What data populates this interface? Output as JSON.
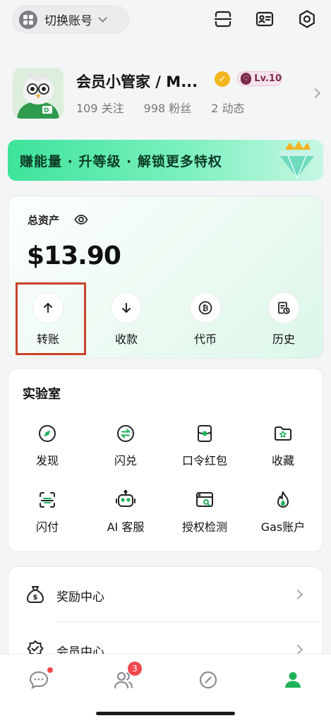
{
  "topbar": {
    "switch_label": "切换账号"
  },
  "profile": {
    "name": "会员小管家 / M...",
    "verified_mark": "✓",
    "level": "Lv.10",
    "following": "109 关注",
    "followers": "998 粉丝",
    "posts": "2 动态"
  },
  "banner": {
    "text": "赚能量 · 升等级 · 解锁更多特权"
  },
  "assets": {
    "title": "总资产",
    "amount": "$13.90",
    "actions": [
      {
        "label": "转账",
        "icon": "arrow-up-icon"
      },
      {
        "label": "收款",
        "icon": "arrow-down-icon"
      },
      {
        "label": "代币",
        "icon": "coin-icon"
      },
      {
        "label": "历史",
        "icon": "history-icon"
      }
    ]
  },
  "lab": {
    "title": "实验室",
    "items": [
      {
        "label": "发现",
        "icon": "compass-icon"
      },
      {
        "label": "闪兑",
        "icon": "swap-icon"
      },
      {
        "label": "口令红包",
        "icon": "red-packet-icon"
      },
      {
        "label": "收藏",
        "icon": "favorite-folder-icon"
      },
      {
        "label": "闪付",
        "icon": "scan-pay-icon"
      },
      {
        "label": "AI 客服",
        "icon": "robot-icon"
      },
      {
        "label": "授权检测",
        "icon": "auth-check-icon"
      },
      {
        "label": "Gas账户",
        "icon": "flame-icon"
      }
    ]
  },
  "menu": {
    "items": [
      {
        "label": "奖励中心",
        "icon": "money-bag-icon"
      },
      {
        "label": "会员中心",
        "icon": "member-badge-icon"
      }
    ]
  },
  "tabbar": {
    "contacts_badge": "3"
  },
  "colors": {
    "accent": "#1fb25a",
    "highlight_border": "#c9432a",
    "badge_red": "#f0484e"
  }
}
